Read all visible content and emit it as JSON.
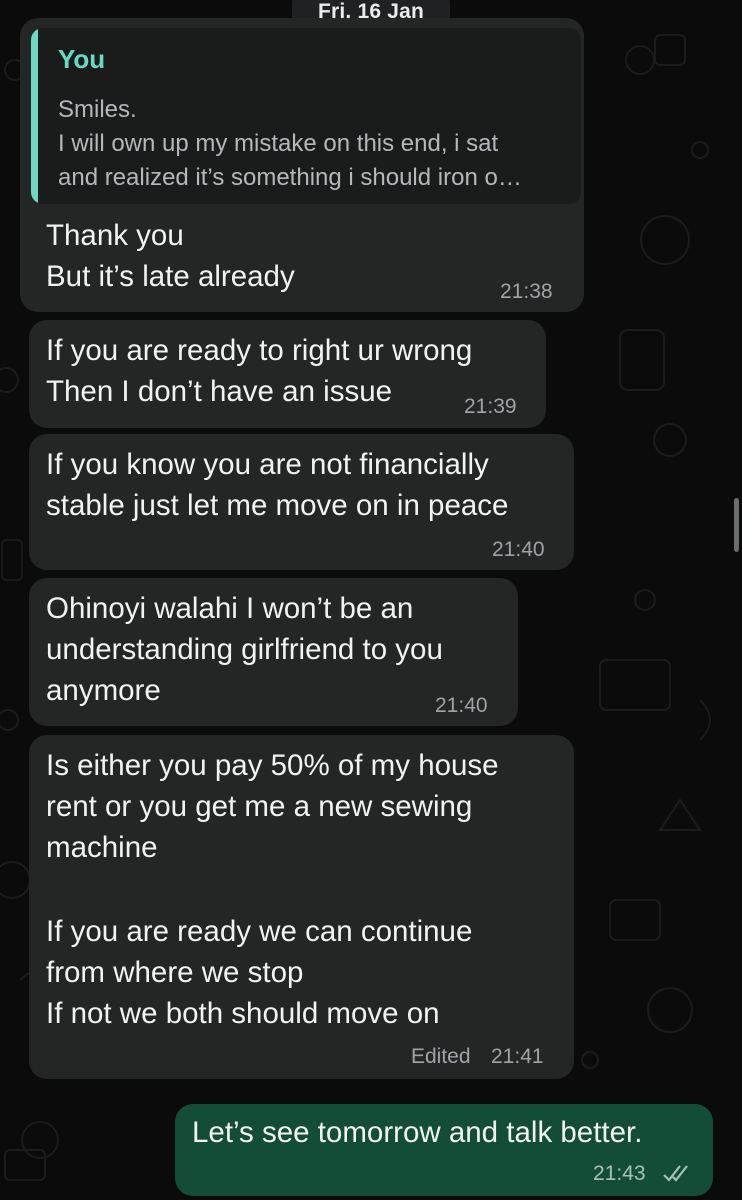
{
  "date_chip": "Fri, 16 Jan",
  "messages": [
    {
      "direction": "incoming",
      "quote": {
        "author": "You",
        "lines": [
          "Smiles.",
          "I will own up my mistake on this end, i sat",
          "and realized it’s something i should iron o…"
        ]
      },
      "lines": [
        "Thank you",
        "But it’s late already"
      ],
      "time": "21:38"
    },
    {
      "direction": "incoming",
      "lines": [
        "If you are ready to right ur wrong",
        "Then I don’t have an issue"
      ],
      "time": "21:39"
    },
    {
      "direction": "incoming",
      "lines": [
        "If you know you are not financially",
        "stable just let me move on in peace"
      ],
      "time": "21:40"
    },
    {
      "direction": "incoming",
      "lines": [
        "Ohinoyi walahi I won’t be an",
        "understanding girlfriend to you",
        "anymore"
      ],
      "time": "21:40"
    },
    {
      "direction": "incoming",
      "lines": [
        "Is either you pay 50% of my house",
        "rent or you get me a new sewing",
        "machine",
        "",
        "If you are ready we can continue",
        "from where we stop",
        "If not we both should move on"
      ],
      "edited_label": "Edited",
      "time": "21:41"
    },
    {
      "direction": "outgoing",
      "lines": [
        "Let’s see tomorrow and talk better."
      ],
      "time": "21:43",
      "status_icon": "double-check-icon"
    }
  ],
  "colors": {
    "background": "#0b0b0b",
    "incoming_bubble": "#242626",
    "outgoing_bubble": "#144d37",
    "quote_accent": "#6bd8c4"
  }
}
